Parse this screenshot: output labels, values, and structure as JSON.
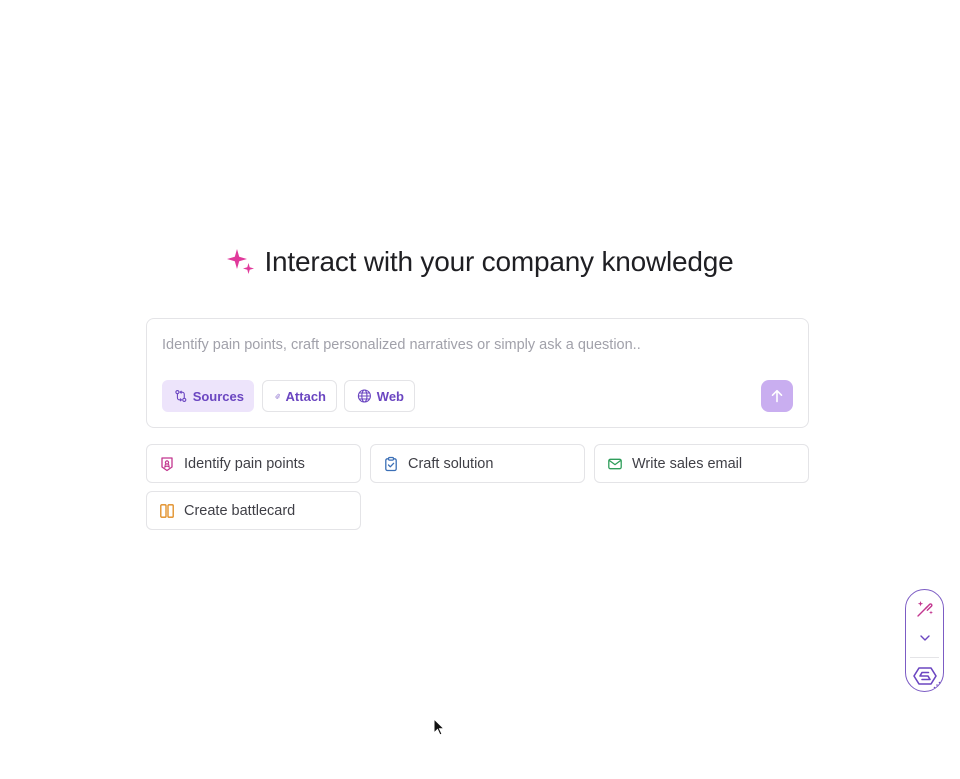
{
  "hero": {
    "title": "Interact with your company knowledge",
    "icon": "sparkles-icon",
    "icon_color": "#e0399b"
  },
  "composer": {
    "placeholder": "Identify pain points, craft personalized narratives or simply ask a question..",
    "value": "",
    "chips": {
      "sources": "Sources",
      "attach": "Attach",
      "web": "Web"
    },
    "accent_color": "#6b46c1",
    "send_button_color": "#c9aef0"
  },
  "suggestions": [
    {
      "label": "Identify pain points",
      "icon": "shield-badge-icon",
      "color": "#c2368f"
    },
    {
      "label": "Craft solution",
      "icon": "clipboard-check-icon",
      "color": "#3b6fb6"
    },
    {
      "label": "Write sales email",
      "icon": "mail-icon",
      "color": "#2f9e5b"
    },
    {
      "label": "Create battlecard",
      "icon": "columns-icon",
      "color": "#e08a1e"
    }
  ],
  "widget": {
    "icons": [
      "magic-wand-icon",
      "chevron-down-icon",
      "app-logo-icon"
    ],
    "border_color": "#7c5cc4"
  }
}
